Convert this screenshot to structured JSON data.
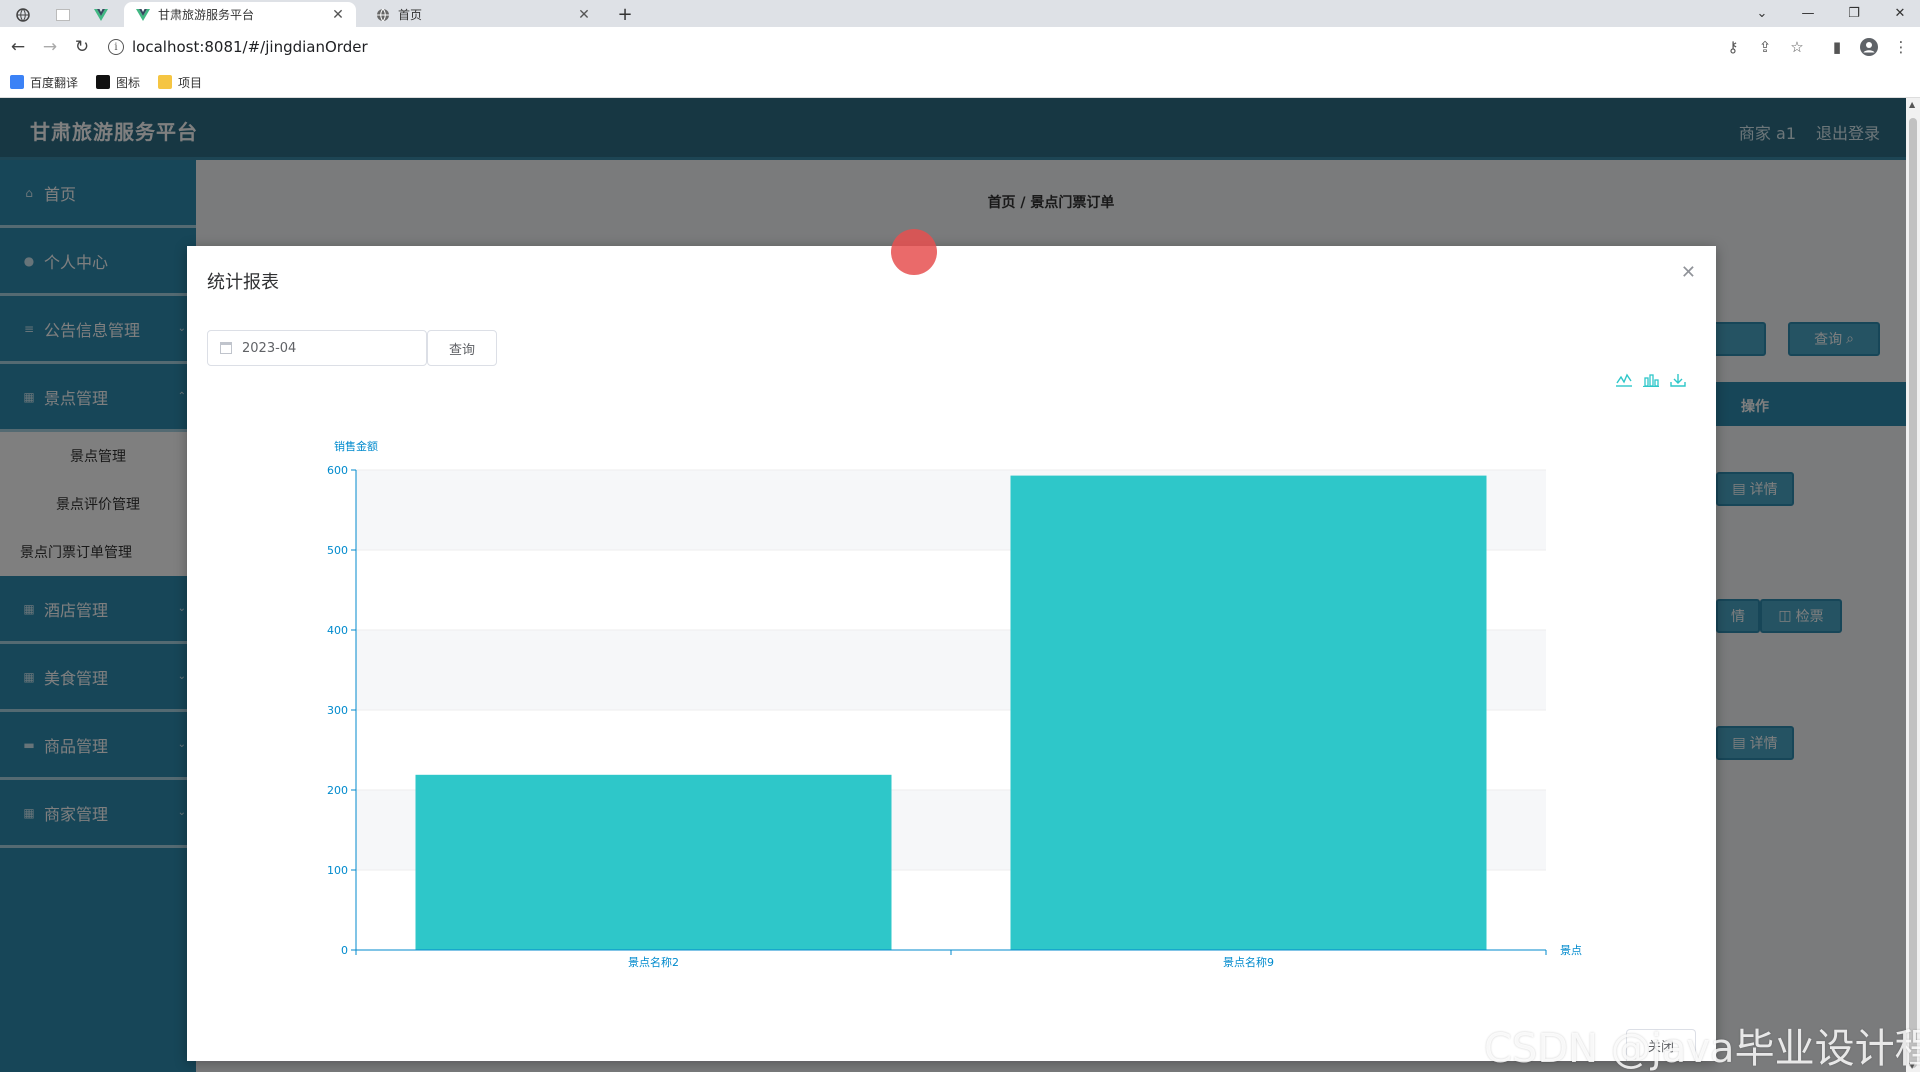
{
  "browser": {
    "tabs": [
      {
        "title": "甘肃旅游服务平台",
        "active": true
      },
      {
        "title": "首页",
        "active": false
      }
    ],
    "address": "localhost:8081/#/jingdianOrder",
    "bookmarks": [
      "百度翻译",
      "图标",
      "项目"
    ]
  },
  "app": {
    "title": "甘肃旅游服务平台",
    "user": "商家 a1",
    "logout": "退出登录",
    "menu": [
      {
        "label": "首页"
      },
      {
        "label": "个人中心"
      },
      {
        "label": "公告信息管理"
      },
      {
        "label": "景点管理"
      }
    ],
    "submenu": [
      "景点管理",
      "景点评价管理",
      "景点门票订单管理"
    ],
    "menu_after": [
      {
        "label": "酒店管理"
      },
      {
        "label": "美食管理"
      },
      {
        "label": "商品管理"
      },
      {
        "label": "商家管理"
      }
    ],
    "breadcrumb": "首页 / 景点门票订单",
    "bg_query": "查询",
    "bg_op_header": "操作",
    "bg_detail": "详情",
    "bg_detail_partial": "情",
    "bg_check": "检票"
  },
  "dialog": {
    "title": "统计报表",
    "date_value": "2023-04",
    "query_label": "查询",
    "close_label": "关闭",
    "tool_icons": [
      "line-chart-icon",
      "bar-chart-icon",
      "download-icon"
    ]
  },
  "chart_data": {
    "type": "bar",
    "ylabel": "销售金额",
    "xlabel": "景点",
    "categories": [
      "景点名称2",
      "景点名称9"
    ],
    "values": [
      219,
      593
    ],
    "ylim": [
      0,
      600
    ],
    "yticks": [
      0,
      100,
      200,
      300,
      400,
      500,
      600
    ],
    "bar_color": "#2ec7c9",
    "axis_color": "#008acd",
    "grid": true
  },
  "watermark": "CSDN @java毕业设计程序"
}
